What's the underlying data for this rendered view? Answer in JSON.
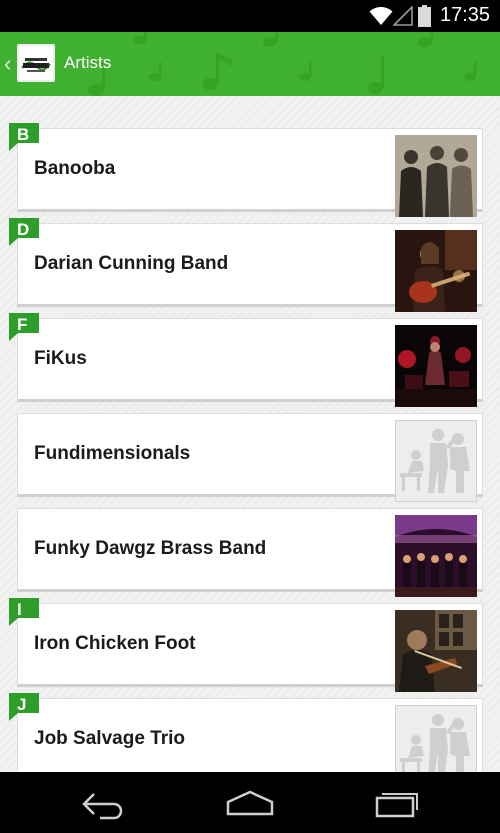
{
  "status_bar": {
    "time": "17:35",
    "icons": [
      "wifi-icon",
      "cell-signal-icon",
      "battery-icon"
    ]
  },
  "action_bar": {
    "title": "Artists",
    "logo_text": "HARDIN'S SWEETWATER"
  },
  "colors": {
    "accent": "#3fb02f",
    "badge": "#2e9e2a",
    "status_bar": "#000000",
    "navigation_bar": "#000000"
  },
  "artists": [
    {
      "name": "Banooba",
      "section": "B",
      "image": "band-photo"
    },
    {
      "name": "Darian Cunning Band",
      "section": "D",
      "image": "guitarist-photo"
    },
    {
      "name": "FiKus",
      "section": "F",
      "image": "stage-photo"
    },
    {
      "name": "Fundimensionals",
      "section": "",
      "image": "placeholder-silhouette"
    },
    {
      "name": "Funky Dawgz Brass Band",
      "section": "",
      "image": "brass-band-photo"
    },
    {
      "name": "Iron Chicken Foot",
      "section": "I",
      "image": "fiddler-photo"
    },
    {
      "name": "Job Salvage Trio",
      "section": "J",
      "image": "placeholder-silhouette"
    }
  ],
  "navigation_bar": {
    "buttons": [
      "back-icon",
      "home-icon",
      "recent-apps-icon"
    ]
  }
}
